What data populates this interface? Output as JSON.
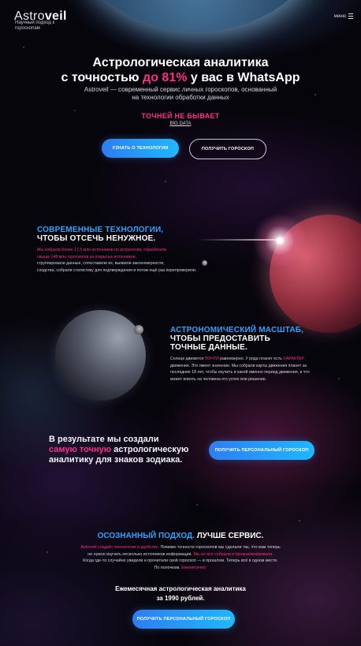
{
  "header": {
    "logo_part1": "Astro",
    "logo_part2": "veil",
    "tagline": "Научный подход к гороскопам",
    "menu_label": "меню"
  },
  "hero": {
    "title_line1": "Астрологическая аналитика",
    "title_line2_a": "с точностью ",
    "title_line2_highlight": "до 81%",
    "title_line2_b": " у вас в WhatsApp",
    "subtitle_line1": "Astroveil — современный сервис личных гороскопов, основанный",
    "subtitle_line2": "на технологии обработки данных",
    "badge": "ТОЧНЕЙ НЕ БЫВАЕТ",
    "badge_link": "BIG DATA",
    "btn_learn": "УЗНАТЬ О ТЕХНОЛОГИИ",
    "btn_get": "ПОЛУЧИТЬ ГОРОСКОП"
  },
  "tech": {
    "title_line1": "СОВРЕМЕННЫЕ ТЕХНОЛОГИИ,",
    "title_line2": "ЧТОБЫ ОТСЕЧЬ НЕНУЖНОЕ.",
    "p_hl1": "Мы собрали более 17,5 млн источников по астрологии, обработали",
    "p_hl2": "свыше 148 млн гороскопов из открытых источников,",
    "p_line3": "сгруппировали данные, сопоставили их, выявили закономерности,",
    "p_line4": "сходства, собрали статистику для подтверждения и потом ещё раз перепроверили."
  },
  "astro": {
    "title_line1": "АСТРОНОМИЧЕСКИЙ МАСШТАБ,",
    "title_line2": "ЧТОБЫ ПРЕДОСТАВИТЬ",
    "title_line3": "ТОЧНЫЕ ДАННЫЕ.",
    "p1_a": "Солнце движется ",
    "p1_hl": "ПОЧТИ",
    "p1_b": " равномерно. У ряда планет есть ",
    "p1_hl2": "ХАРАКТЕР",
    "p2": "движения. Это имеет значение. Мы собрали карты движения планет за",
    "p3": "последние 18 лет, чтобы изучить в какой именно период движения, и что",
    "p4": "может влиять на человека его успех или решение."
  },
  "result": {
    "line1": "В результате мы создали",
    "line2_hl": "самую точную",
    "line2_b": " астрологическую",
    "line3": "аналитику для знаков зодиака.",
    "button": "ПОЛУЧИТЬ ПЕРСОНАЛЬНЫЙ ГОРОСКОП"
  },
  "service": {
    "title_hl": "ОСОЗНАННЫЙ ПОДХОД.",
    "title_b": " ЛУЧШЕ СЕРВИС.",
    "p1_hl": "Astroveil создаёт технологии и удобство.",
    "p1_b": " Помимо точности гороскопов мы сделали так, что вам теперь",
    "p2_a": "не нужно изучать несколько источников информации. ",
    "p2_hl": "Мы их все собрали и проанализировали.",
    "p3": "Когда где-то случайно увидели и прочитали свой гороскоп — в прошлом. Теперь всё в одном месте.",
    "p4_a": "По полочкам. ",
    "p4_hl": "Ежемесячно.",
    "price_line1": "Ежемесячная астрологическая аналитика",
    "price_line2": "за 1990 рублей.",
    "button": "ПОЛУЧИТЬ ПЕРСОНАЛЬНЫЙ ГОРОСКОП"
  },
  "colors": {
    "accent_pink": "#ff2f86",
    "accent_blue": "#2fa3ff",
    "button_gradient_start": "#2e7df0",
    "button_gradient_end": "#1fb8ff"
  }
}
